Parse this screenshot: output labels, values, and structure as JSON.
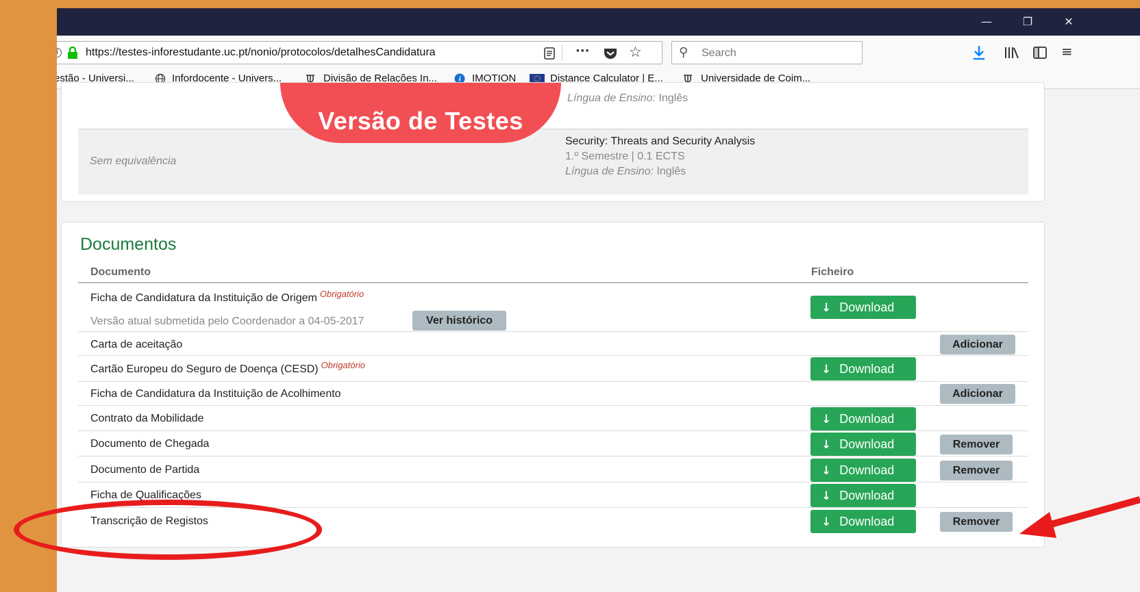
{
  "browser": {
    "url": "https://testes-inforestudante.uc.pt/nonio/protocolos/detalhesCandidatura",
    "search_placeholder": "Search",
    "bookmarks": [
      "estão - Universi...",
      "Infordocente - Univers...",
      "Divisão de Relações In...",
      "IMOTION",
      "Distance Calculator | E...",
      "Universidade de Coim..."
    ]
  },
  "banner": "Versão de Testes",
  "courses": {
    "row1": {
      "equivalence": "Sem equivalência",
      "language_label": "Língua de Ensino:",
      "language": "Inglês"
    },
    "row2": {
      "equivalence": "Sem equivalência",
      "title": "Security: Threats and Security Analysis",
      "details": "1.º Semestre | 0.1 ECTS",
      "language_label": "Língua de Ensino:",
      "language": "Inglês"
    }
  },
  "documents": {
    "title": "Documentos",
    "col_document": "Documento",
    "col_file": "Ficheiro",
    "required_label": "Obrigatório",
    "download_label": "Download",
    "add_label": "Adicionar",
    "remove_label": "Remover",
    "history_label": "Ver histórico",
    "version_note": "Versão atual submetida pelo Coordenador a 04-05-2017",
    "rows": [
      "Ficha de Candidatura da Instituição de Origem",
      "Carta de aceitação",
      "Cartão Europeu do Seguro de Doença (CESD)",
      "Ficha de Candidatura da Instituição de Acolhimento",
      "Contrato da Mobilidade",
      "Documento de Chegada",
      "Documento de Partida",
      "Ficha de Qualificações",
      "Transcrição de Registos"
    ]
  },
  "colors": {
    "accent_green": "#27a657",
    "title_green": "#1b7a3c",
    "banner_red": "#f24f54",
    "annotation_red": "#e81c1c"
  }
}
